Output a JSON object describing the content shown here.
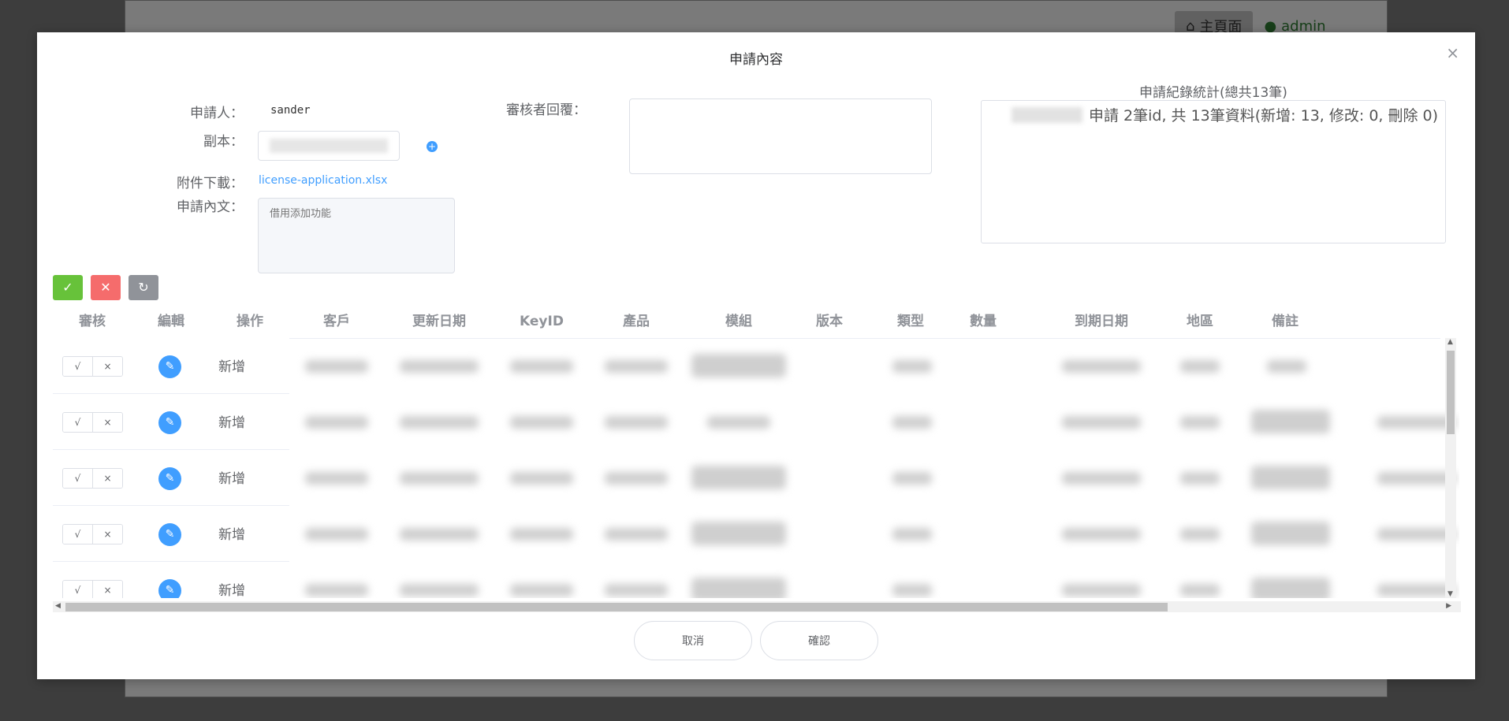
{
  "background": {
    "home_label": "主頁面",
    "admin_label": "admin"
  },
  "dialog": {
    "title": "申請內容",
    "close_icon": "close-icon"
  },
  "form": {
    "applicant_label": "申請人：",
    "applicant_value": "sander",
    "cc_label": "副本：",
    "attachment_label": "附件下載：",
    "attachment_link": "license-application.xlsx",
    "content_label": "申請內文：",
    "content_placeholder": "借用添加功能",
    "reviewer_reply_label": "審核者回覆："
  },
  "stats": {
    "title": "申請紀錄統計(總共13筆)",
    "summary": "申請 2筆id, 共 13筆資料(新增: 13, 修改: 0, 刪除 0)"
  },
  "toolbar": {
    "approve_all_icon": "check-icon",
    "reject_all_icon": "close-icon",
    "refresh_icon": "refresh-icon"
  },
  "table": {
    "columns": [
      "審核",
      "編輯",
      "操作",
      "客戶",
      "更新日期",
      "KeyID",
      "產品",
      "模組",
      "版本",
      "類型",
      "數量",
      "到期日期",
      "地區",
      "備註"
    ],
    "approve_label": "√",
    "reject_label": "×",
    "rows": [
      {
        "operation": "新增"
      },
      {
        "operation": "新增"
      },
      {
        "operation": "新增"
      },
      {
        "operation": "新增"
      },
      {
        "operation": "新增"
      }
    ]
  },
  "footer": {
    "cancel_label": "取消",
    "confirm_label": "確認"
  }
}
